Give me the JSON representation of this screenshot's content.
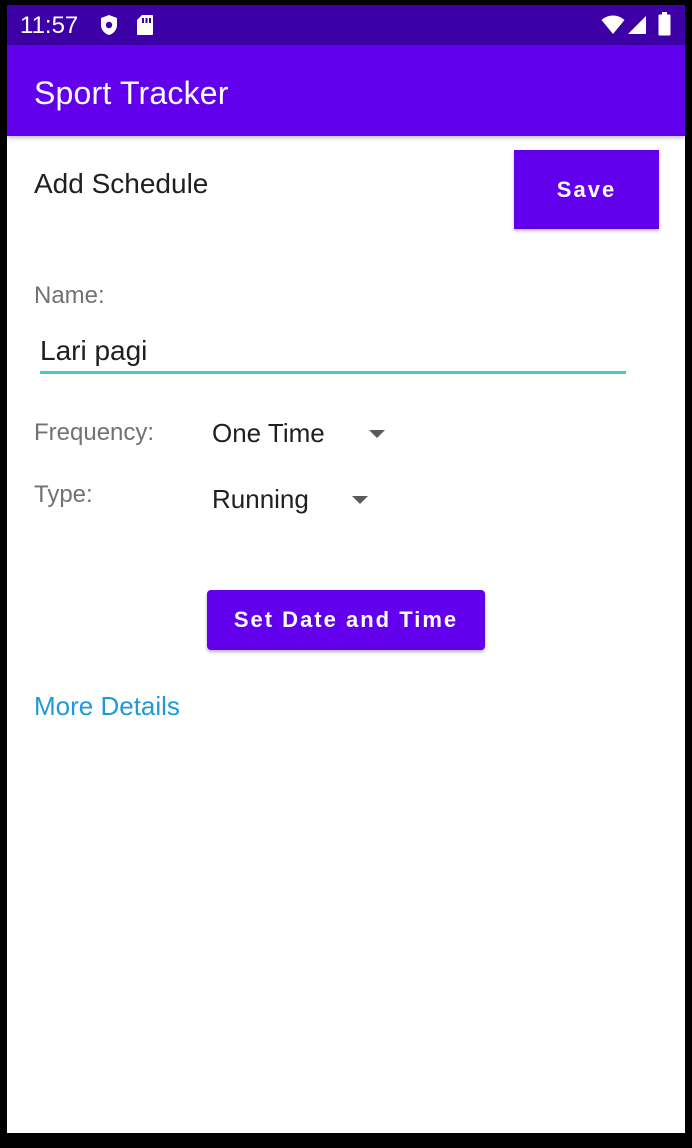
{
  "status_bar": {
    "time": "11:57",
    "icons": [
      "shield-icon",
      "sd-card-icon",
      "wifi-icon",
      "signal-icon",
      "battery-icon"
    ]
  },
  "app_bar": {
    "title": "Sport Tracker"
  },
  "page": {
    "title": "Add Schedule",
    "save_label": "Save"
  },
  "form": {
    "name_label": "Name:",
    "name_value": "Lari pagi",
    "frequency_label": "Frequency:",
    "frequency_value": "One Time",
    "type_label": "Type:",
    "type_value": "Running",
    "set_date_label": "Set Date and Time",
    "more_details_label": "More Details"
  },
  "colors": {
    "primary": "#6200ee",
    "primary_dark": "#3c00a6",
    "input_underline": "#3ecfc2",
    "link": "#1e9ad6"
  }
}
